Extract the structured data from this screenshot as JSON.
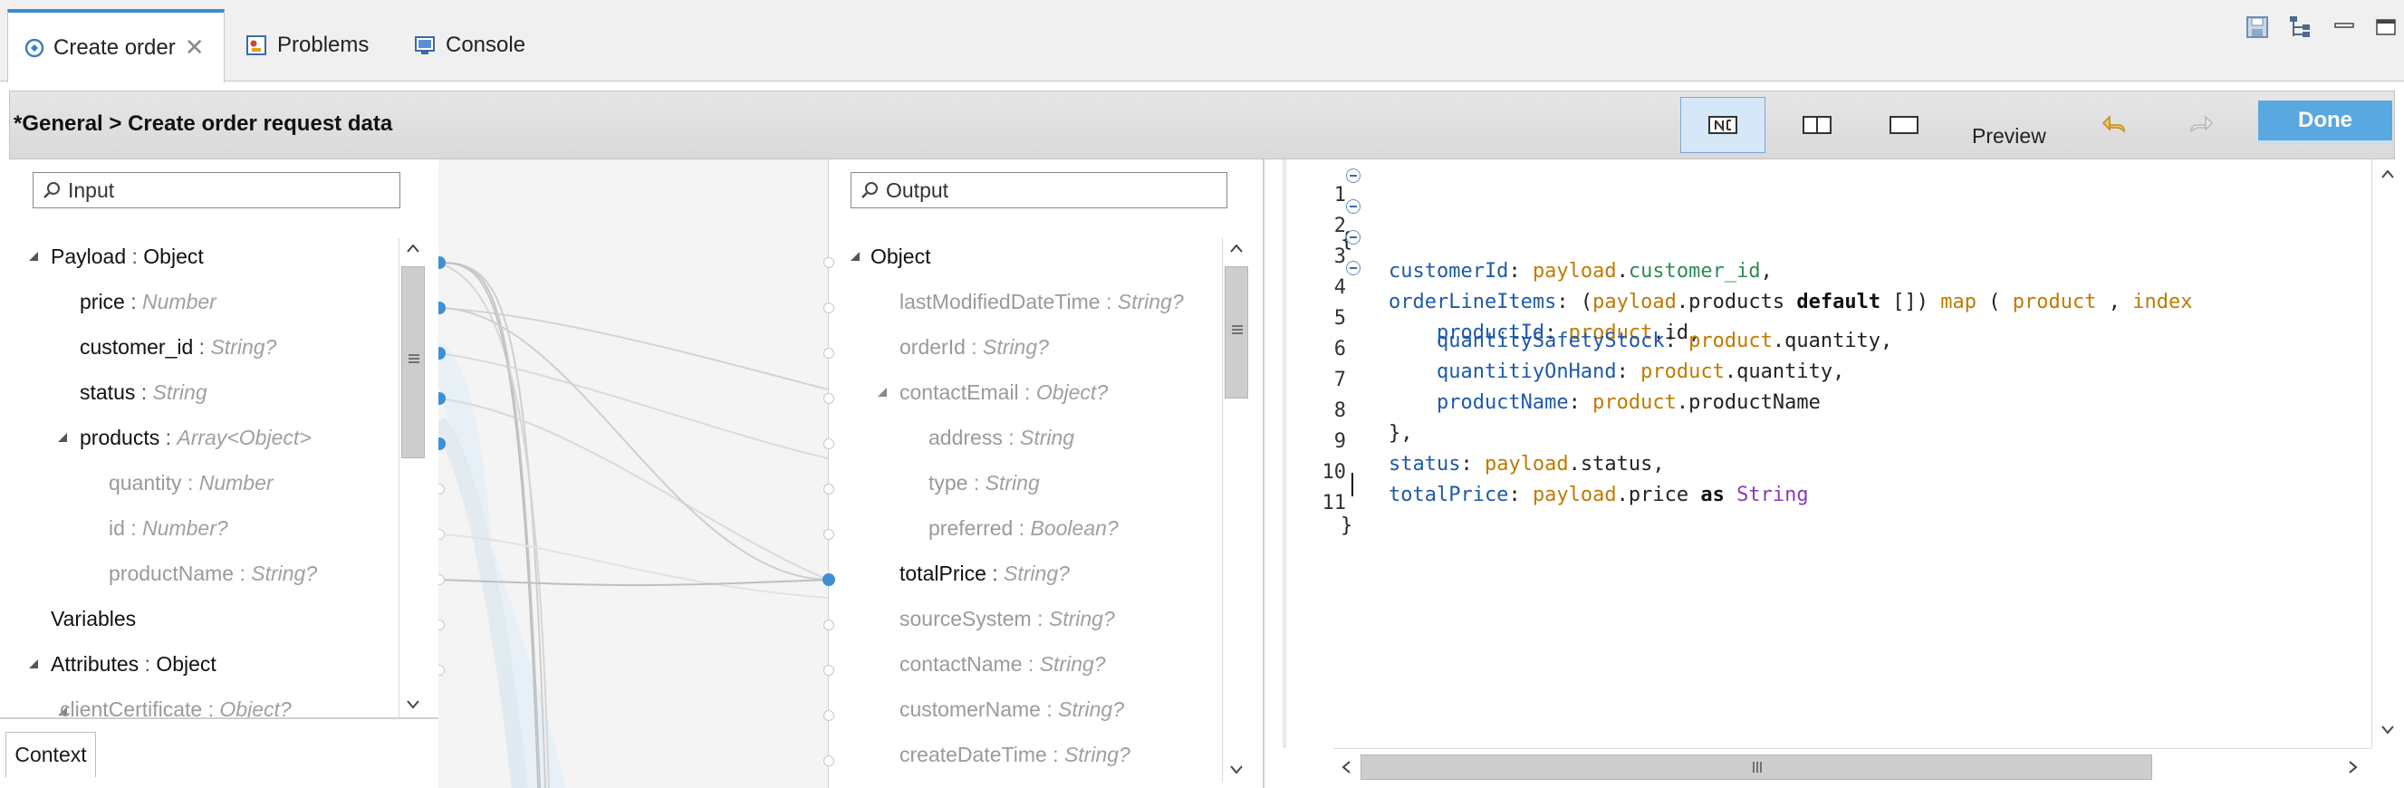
{
  "tabs": [
    {
      "label": "Create order",
      "active": true,
      "closable": true,
      "icon": "dataweave-icon"
    },
    {
      "label": "Problems",
      "active": false,
      "icon": "problems-icon"
    },
    {
      "label": "Console",
      "active": false,
      "icon": "console-icon"
    }
  ],
  "window_controls": [
    "save-icon",
    "tree-icon",
    "minimize-icon",
    "maximize-icon"
  ],
  "header": {
    "breadcrumb": "*General > Create order request data",
    "view_buttons": [
      "graphical-source-view-icon",
      "split-view-icon",
      "source-only-view-icon"
    ],
    "preview_label": "Preview",
    "undo_icon": "undo-arrow-icon",
    "redo_icon": "redo-arrow-icon",
    "done_label": "Done",
    "accent_color": "#5aa8e0"
  },
  "input": {
    "search_placeholder": "Input",
    "tree": [
      {
        "name": "Payload",
        "sep": " : ",
        "type": "Object",
        "expanded": true
      },
      {
        "name": "price",
        "sep": " : ",
        "type": "Number"
      },
      {
        "name": "customer_id",
        "sep": " : ",
        "type": "String?"
      },
      {
        "name": "status",
        "sep": " : ",
        "type": "String"
      },
      {
        "name": "products",
        "sep": " : ",
        "type": "Array<Object>",
        "expanded": true
      },
      {
        "name": "quantity",
        "sep": " : ",
        "type": "Number"
      },
      {
        "name": "id",
        "sep": " : ",
        "type": "Number?"
      },
      {
        "name": "productName",
        "sep": " : ",
        "type": "String?"
      },
      {
        "name": "Variables",
        "sep": "",
        "type": ""
      },
      {
        "name": "Attributes",
        "sep": " : ",
        "type": "Object",
        "expanded": true
      },
      {
        "name": "clientCertificate",
        "sep": " : ",
        "type": "Object?",
        "expanded": true
      }
    ],
    "context_tab": "Context"
  },
  "output": {
    "search_placeholder": "Output",
    "tree": [
      {
        "name": "Object",
        "sep": "",
        "type": "",
        "expanded": true
      },
      {
        "name": "lastModifiedDateTime",
        "sep": " : ",
        "type": "String?"
      },
      {
        "name": "orderId",
        "sep": " : ",
        "type": "String?"
      },
      {
        "name": "contactEmail",
        "sep": " : ",
        "type": "Object?",
        "expanded": true
      },
      {
        "name": "address",
        "sep": " : ",
        "type": "String"
      },
      {
        "name": "type",
        "sep": " : ",
        "type": "String"
      },
      {
        "name": "preferred",
        "sep": " : ",
        "type": "Boolean?"
      },
      {
        "name": "totalPrice",
        "sep": " : ",
        "type": "String?",
        "mapped": true
      },
      {
        "name": "sourceSystem",
        "sep": " : ",
        "type": "String?"
      },
      {
        "name": "contactName",
        "sep": " : ",
        "type": "String?"
      },
      {
        "name": "customerName",
        "sep": " : ",
        "type": "String?"
      },
      {
        "name": "createDateTime",
        "sep": " : ",
        "type": "String?"
      }
    ]
  },
  "editor": {
    "line_numbers": [
      "1",
      "2",
      "3",
      "4",
      "5",
      "6",
      "7",
      "8",
      "9",
      "10",
      "11"
    ],
    "lines": [
      [
        {
          "c": "p",
          "t": "{"
        }
      ],
      [
        {
          "c": "k",
          "t": "    customerId"
        },
        {
          "c": "p",
          "t": ": "
        },
        {
          "c": "v",
          "t": "payload"
        },
        {
          "c": "p",
          "t": "."
        },
        {
          "c": "s",
          "t": "customer_id"
        },
        {
          "c": "p",
          "t": ","
        }
      ],
      [
        {
          "c": "k",
          "t": "    orderLineItems"
        },
        {
          "c": "p",
          "t": ": ("
        },
        {
          "c": "v",
          "t": "payload"
        },
        {
          "c": "p",
          "t": ".products "
        },
        {
          "c": "b",
          "t": "default"
        },
        {
          "c": "p",
          "t": " []) "
        },
        {
          "c": "v",
          "t": "map"
        },
        {
          "c": "p",
          "t": " ( "
        },
        {
          "c": "v",
          "t": "product"
        },
        {
          "c": "p",
          "t": " , "
        },
        {
          "c": "v",
          "t": "index"
        }
      ],
      [
        {
          "c": "k",
          "t": "        productId"
        },
        {
          "c": "p",
          "t": ": "
        },
        {
          "c": "v",
          "t": "product"
        },
        {
          "c": "p",
          "t": ".id,"
        }
      ],
      [
        {
          "c": "k",
          "t": "        quantitySafetyStock"
        },
        {
          "c": "p",
          "t": ": "
        },
        {
          "c": "v",
          "t": "product"
        },
        {
          "c": "p",
          "t": ".quantity,"
        }
      ],
      [
        {
          "c": "k",
          "t": "        quantitiyOnHand"
        },
        {
          "c": "p",
          "t": ": "
        },
        {
          "c": "v",
          "t": "product"
        },
        {
          "c": "p",
          "t": ".quantity,"
        }
      ],
      [
        {
          "c": "k",
          "t": "        productName"
        },
        {
          "c": "p",
          "t": ": "
        },
        {
          "c": "v",
          "t": "product"
        },
        {
          "c": "p",
          "t": ".productName"
        }
      ],
      [
        {
          "c": "p",
          "t": "    },"
        }
      ],
      [
        {
          "c": "k",
          "t": "    status"
        },
        {
          "c": "p",
          "t": ": "
        },
        {
          "c": "v",
          "t": "payload"
        },
        {
          "c": "p",
          "t": ".status,"
        }
      ],
      [
        {
          "c": "k",
          "t": "    totalPrice"
        },
        {
          "c": "p",
          "t": ": "
        },
        {
          "c": "v",
          "t": "payload"
        },
        {
          "c": "p",
          "t": ".price "
        },
        {
          "c": "b",
          "t": "as"
        },
        {
          "c": "p",
          "t": " "
        },
        {
          "c": "t",
          "t": "String"
        }
      ],
      [
        {
          "c": "p",
          "t": "}"
        }
      ]
    ]
  }
}
